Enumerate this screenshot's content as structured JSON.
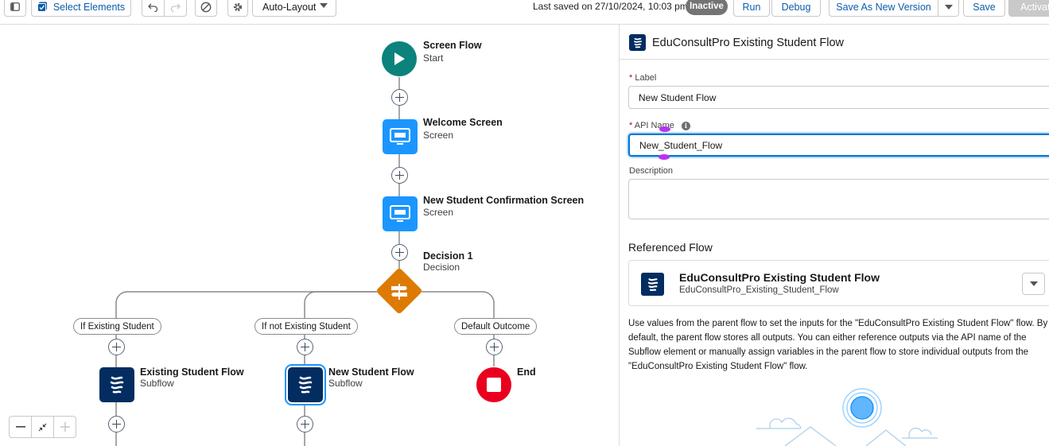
{
  "toolbar": {
    "select_elements": "Select Elements",
    "auto_layout": "Auto-Layout",
    "last_saved": "Last saved on 27/10/2024, 10:03 pm",
    "status": "Inactive",
    "run": "Run",
    "debug": "Debug",
    "save_as_new_version": "Save As New Version",
    "save": "Save",
    "activate": "Activate"
  },
  "canvas": {
    "start": {
      "title": "Screen Flow",
      "subtitle": "Start"
    },
    "welcome": {
      "title": "Welcome Screen",
      "subtitle": "Screen"
    },
    "confirmation": {
      "title": "New Student Confirmation Screen",
      "subtitle": "Screen"
    },
    "decision": {
      "title": "Decision 1",
      "subtitle": "Decision"
    },
    "outcomes": [
      "If Existing Student",
      "If not Existing Student",
      "Default Outcome"
    ],
    "existing_subflow": {
      "title": "Existing Student Flow",
      "subtitle": "Subflow"
    },
    "new_subflow": {
      "title": "New Student Flow",
      "subtitle": "Subflow"
    },
    "end": {
      "title": "End"
    }
  },
  "panel": {
    "header_title": "EduConsultPro Existing Student Flow",
    "label_field": {
      "label": "Label",
      "value": "New Student Flow"
    },
    "api_name_field": {
      "label": "API Name",
      "value": "New_Student_Flow"
    },
    "description_field": {
      "label": "Description",
      "value": ""
    },
    "referenced_flow_title": "Referenced Flow",
    "referenced_flow": {
      "name": "EduConsultPro Existing Student Flow",
      "api_name": "EduConsultPro_Existing_Student_Flow"
    },
    "help_text": "Use values from the parent flow to set the inputs for the \"EduConsultPro Existing Student Flow\" flow. By default, the parent flow stores all outputs. You can either reference outputs via the API name of the Subflow element or manually assign variables in the parent flow to store individual outputs from the \"EduConsultPro Existing Student Flow\" flow."
  },
  "colors": {
    "start": "#0b827c",
    "screen": "#1b96ff",
    "decision": "#dd7a01",
    "subflow": "#032d60",
    "end": "#ea001e",
    "brand_blue": "#0176d3"
  }
}
